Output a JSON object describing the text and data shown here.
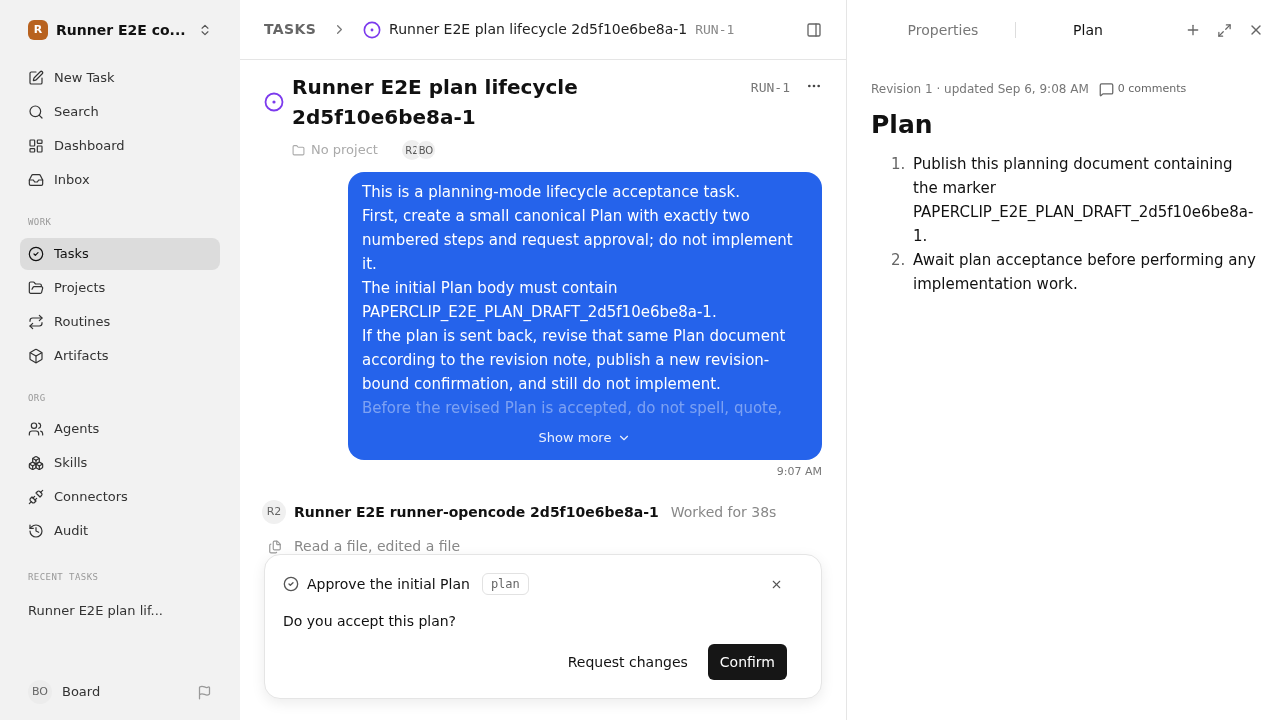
{
  "workspace": {
    "initial": "R",
    "name": "Runner E2E co..."
  },
  "nav": [
    {
      "label": "New Task",
      "selected": false
    },
    {
      "label": "Search",
      "selected": false
    },
    {
      "label": "Dashboard",
      "selected": false
    },
    {
      "label": "Inbox",
      "selected": false
    }
  ],
  "sections": [
    {
      "title": "WORK",
      "items": [
        {
          "label": "Tasks",
          "selected": true
        },
        {
          "label": "Projects",
          "selected": false
        },
        {
          "label": "Routines",
          "selected": false
        },
        {
          "label": "Artifacts",
          "selected": false
        }
      ]
    },
    {
      "title": "ORG",
      "items": [
        {
          "label": "Agents",
          "selected": false
        },
        {
          "label": "Skills",
          "selected": false
        },
        {
          "label": "Connectors",
          "selected": false
        },
        {
          "label": "Audit",
          "selected": false
        }
      ]
    }
  ],
  "recent": {
    "title": "RECENT TASKS",
    "items": [
      "Runner E2E plan lif..."
    ]
  },
  "user": {
    "initials": "BO",
    "name": "Board"
  },
  "breadcrumb": {
    "root": "TASKS",
    "title": "Runner E2E plan lifecycle 2d5f10e6be8a-1",
    "id": "RUN-1"
  },
  "task": {
    "title": "Runner E2E plan lifecycle 2d5f10e6be8a-1",
    "id": "RUN-1",
    "project": "No project",
    "assignees": [
      "R2",
      "BO"
    ]
  },
  "message": {
    "paragraphs": [
      {
        "text": "This is a planning-mode lifecycle acceptance task.",
        "faded": false
      },
      {
        "text": "First, create a small canonical Plan with exactly two numbered steps and request approval; do not implement it.",
        "faded": false
      },
      {
        "text": "The initial Plan body must contain PAPERCLIP_E2E_PLAN_DRAFT_2d5f10e6be8a-1.",
        "faded": false
      },
      {
        "text": "If the plan is sent back, revise that same Plan document according to the revision note, publish a new revision-bound confirmation, and still do not implement.",
        "faded": false
      },
      {
        "text": "Before the revised Plan is accepted, do not spell, quote,",
        "faded": true
      }
    ],
    "show_more": "Show more",
    "time": "9:07 AM"
  },
  "run": {
    "avatar": "R2",
    "agent": "Runner E2E runner-opencode 2d5f10e6be8a-1",
    "duration": "Worked for 38s",
    "summary": "Read a file, edited a file"
  },
  "approval": {
    "title": "Approve the initial Plan",
    "tag": "plan",
    "question": "Do you accept this plan?",
    "secondary": "Request changes",
    "primary": "Confirm"
  },
  "panel": {
    "tabs": [
      {
        "label": "Properties",
        "selected": false
      },
      {
        "label": "Plan",
        "selected": true
      }
    ],
    "meta": "Revision 1 · updated Sep 6, 9:08 AM",
    "comments": "0 comments",
    "heading": "Plan",
    "steps": [
      {
        "number": "1.",
        "text": "Publish this planning document containing the marker PAPERCLIP_E2E_PLAN_DRAFT_2d5f10e6be8a-1."
      },
      {
        "number": "2.",
        "text": "Await plan acceptance before performing any implementation work."
      }
    ]
  }
}
